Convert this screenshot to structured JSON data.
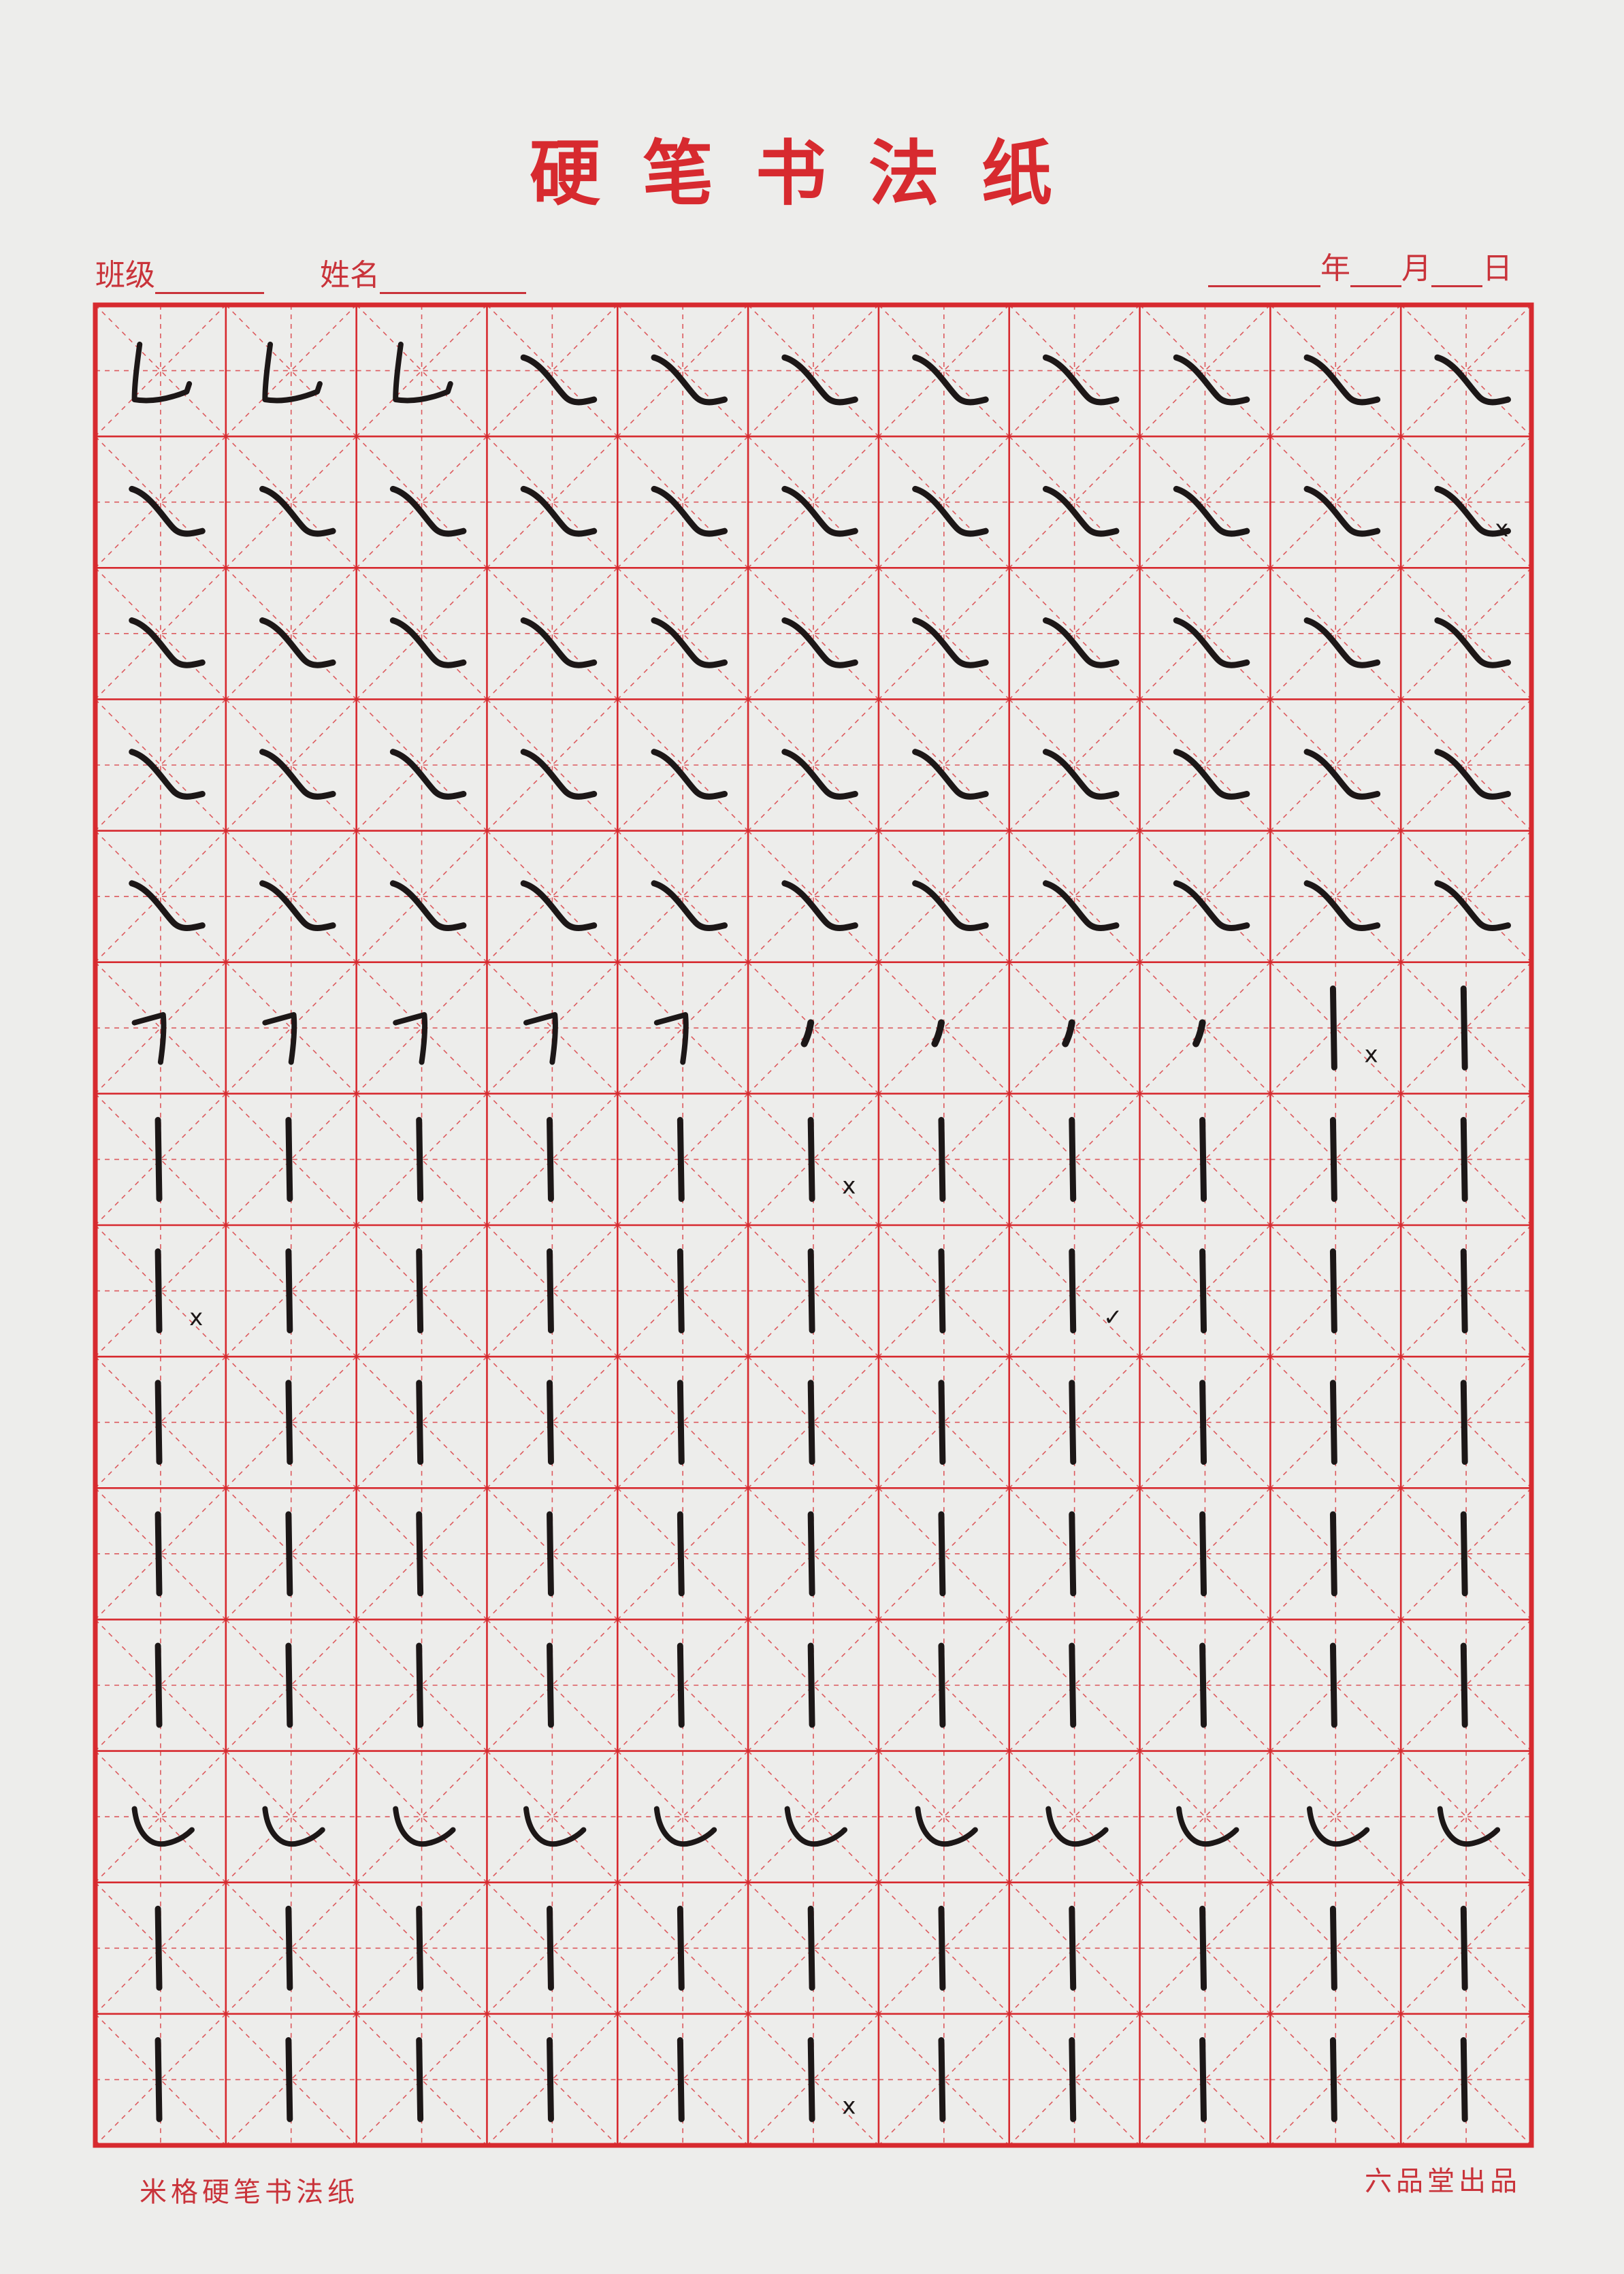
{
  "title": "硬笔书法纸",
  "header": {
    "class_label": "班级",
    "name_label": "姓名",
    "year_label": "年",
    "month_label": "月",
    "day_label": "日"
  },
  "footer": {
    "left": "米格硬笔书法纸",
    "right": "六品堂出品"
  },
  "colors": {
    "grid_red": "#d72a2f",
    "ink": "#1c1717",
    "paper": "#ededeb"
  },
  "grid": {
    "rows": 14,
    "cols": 11,
    "cell_type": "mi-ge",
    "stroke_rows": [
      [
        "zhewan",
        "zhewan",
        "zhewan",
        "na",
        "na",
        "na",
        "na",
        "na",
        "na",
        "na",
        "na"
      ],
      [
        "na",
        "na",
        "na",
        "na",
        "na",
        "na",
        "na",
        "na",
        "na",
        "na",
        "na"
      ],
      [
        "na",
        "na",
        "na",
        "na",
        "na",
        "na",
        "na",
        "na",
        "na",
        "na",
        "na"
      ],
      [
        "na",
        "na",
        "na",
        "na",
        "na",
        "na",
        "na",
        "na",
        "na",
        "na",
        "na"
      ],
      [
        "na",
        "na",
        "na",
        "na",
        "na",
        "na",
        "na",
        "na",
        "na",
        "na",
        "na"
      ],
      [
        "hengzhe",
        "hengzhe",
        "hengzhe",
        "hengzhe",
        "hengzhe",
        "dian",
        "dian",
        "dian",
        "dian",
        "shu",
        "shu"
      ],
      [
        "shu",
        "shu",
        "shu",
        "shu",
        "shu",
        "shu",
        "shu",
        "shu",
        "shu",
        "shu",
        "shu"
      ],
      [
        "shu",
        "shu",
        "shu",
        "shu",
        "shu",
        "shu",
        "shu",
        "shu",
        "shu",
        "shu",
        "shu"
      ],
      [
        "shu",
        "shu",
        "shu",
        "shu",
        "shu",
        "shu",
        "shu",
        "shu",
        "shu",
        "shu",
        "shu"
      ],
      [
        "shu",
        "shu",
        "shu",
        "shu",
        "shu",
        "shu",
        "shu",
        "shu",
        "shu",
        "shu",
        "shu"
      ],
      [
        "shu",
        "shu",
        "shu",
        "shu",
        "shu",
        "shu",
        "shu",
        "shu",
        "shu",
        "shu",
        "shu"
      ],
      [
        "wan",
        "wan",
        "wan",
        "wan",
        "wan",
        "wan",
        "wan",
        "wan",
        "wan",
        "wan",
        "wan"
      ],
      [
        "shu",
        "shu",
        "shu",
        "shu",
        "shu",
        "shu",
        "shu",
        "shu",
        "shu",
        "shu",
        "shu"
      ],
      [
        "shu",
        "shu",
        "shu",
        "shu",
        "shu",
        "shu",
        "shu",
        "shu",
        "shu",
        "shu",
        "shu"
      ]
    ],
    "marks": [
      {
        "row": 1,
        "col": 10,
        "symbol": "x"
      },
      {
        "row": 5,
        "col": 9,
        "symbol": "x"
      },
      {
        "row": 6,
        "col": 5,
        "symbol": "x"
      },
      {
        "row": 7,
        "col": 0,
        "symbol": "x"
      },
      {
        "row": 7,
        "col": 7,
        "symbol": "✓"
      },
      {
        "row": 13,
        "col": 5,
        "symbol": "x"
      }
    ]
  }
}
